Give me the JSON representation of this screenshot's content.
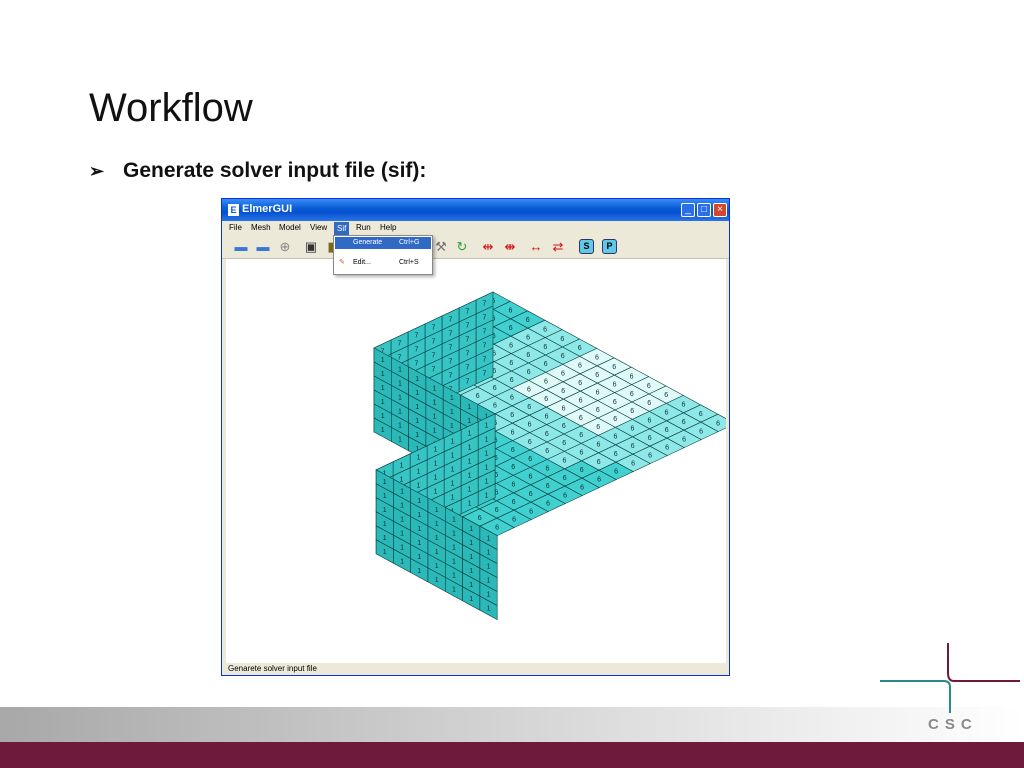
{
  "slide": {
    "title": "Workflow",
    "bullet_marker": "➢",
    "bullet": "Generate solver input file (sif):"
  },
  "window": {
    "title": "ElmerGUI",
    "app_icon": "E",
    "menus": [
      "File",
      "Mesh",
      "Model",
      "View",
      "Sif",
      "Run",
      "Help"
    ],
    "active_menu": "Sif",
    "dropdown": [
      {
        "label": "Generate",
        "shortcut": "Ctrl+G",
        "highlighted": true
      },
      {
        "label": "Edit...",
        "shortcut": "Ctrl+S",
        "highlighted": false
      }
    ],
    "toolbar_icons": [
      "open-icon",
      "open-icon",
      "new-icon",
      "save-icon",
      "save-as-icon",
      "wrench-icon",
      "refresh-icon",
      "divide-icon",
      "unify-icon",
      "divide-edge-icon",
      "unify-edge-icon",
      "start-solver-icon",
      "postprocessor-icon"
    ],
    "toolbar_letters": {
      "solver": "S",
      "post": "P"
    },
    "status": "Genarete solver input file"
  },
  "mesh": {
    "colors": {
      "fill": "#40d0d0",
      "highlight": "#e0fafa",
      "line": "#0a4040"
    },
    "labels": {
      "top": "6",
      "left": "7",
      "front": "1"
    }
  },
  "logo": {
    "text": "CSC"
  },
  "colors": {
    "accent": "#6e1a3c",
    "window_blue": "#0a5fd8",
    "selection": "#316ac5"
  }
}
